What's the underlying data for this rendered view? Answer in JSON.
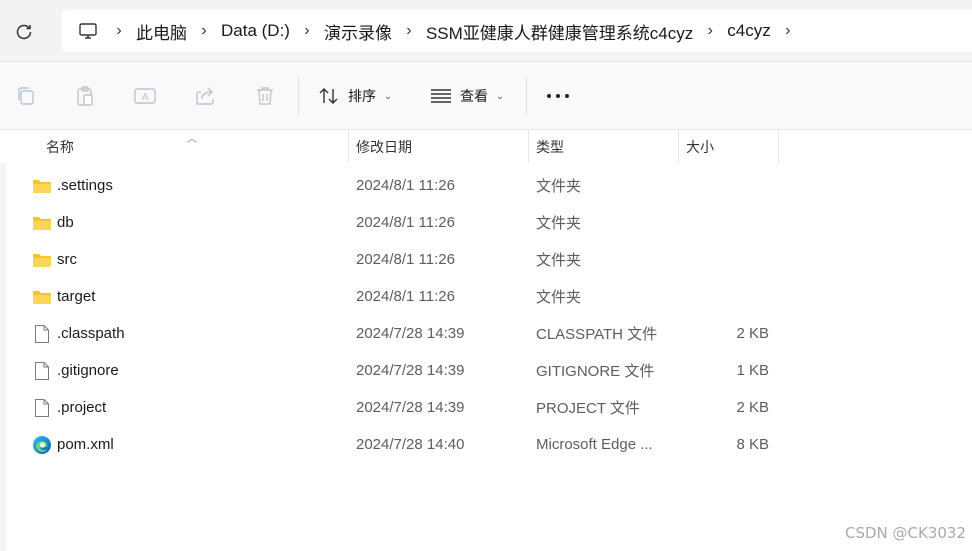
{
  "address_bar": {
    "crumbs": [
      "此电脑",
      "Data (D:)",
      "演示录像",
      "SSM亚健康人群健康管理系统c4cyz",
      "c4cyz"
    ]
  },
  "toolbar": {
    "sort_label": "排序",
    "view_label": "查看"
  },
  "columns": {
    "name": "名称",
    "date": "修改日期",
    "type": "类型",
    "size": "大小"
  },
  "files": [
    {
      "name": ".settings",
      "date": "2024/8/1 11:26",
      "type": "文件夹",
      "size": "",
      "icon": "folder-icon"
    },
    {
      "name": "db",
      "date": "2024/8/1 11:26",
      "type": "文件夹",
      "size": "",
      "icon": "folder-icon"
    },
    {
      "name": "src",
      "date": "2024/8/1 11:26",
      "type": "文件夹",
      "size": "",
      "icon": "folder-icon"
    },
    {
      "name": "target",
      "date": "2024/8/1 11:26",
      "type": "文件夹",
      "size": "",
      "icon": "folder-icon"
    },
    {
      "name": ".classpath",
      "date": "2024/7/28 14:39",
      "type": "CLASSPATH 文件",
      "size": "2 KB",
      "icon": "file-icon"
    },
    {
      "name": ".gitignore",
      "date": "2024/7/28 14:39",
      "type": "GITIGNORE 文件",
      "size": "1 KB",
      "icon": "file-icon"
    },
    {
      "name": ".project",
      "date": "2024/7/28 14:39",
      "type": "PROJECT 文件",
      "size": "2 KB",
      "icon": "file-icon"
    },
    {
      "name": "pom.xml",
      "date": "2024/7/28 14:40",
      "type": "Microsoft Edge ...",
      "size": "8 KB",
      "icon": "edge-icon"
    }
  ],
  "watermark": "CSDN @CK3032",
  "colors": {
    "folder": "#f4c430",
    "accent": "#0067c0"
  }
}
